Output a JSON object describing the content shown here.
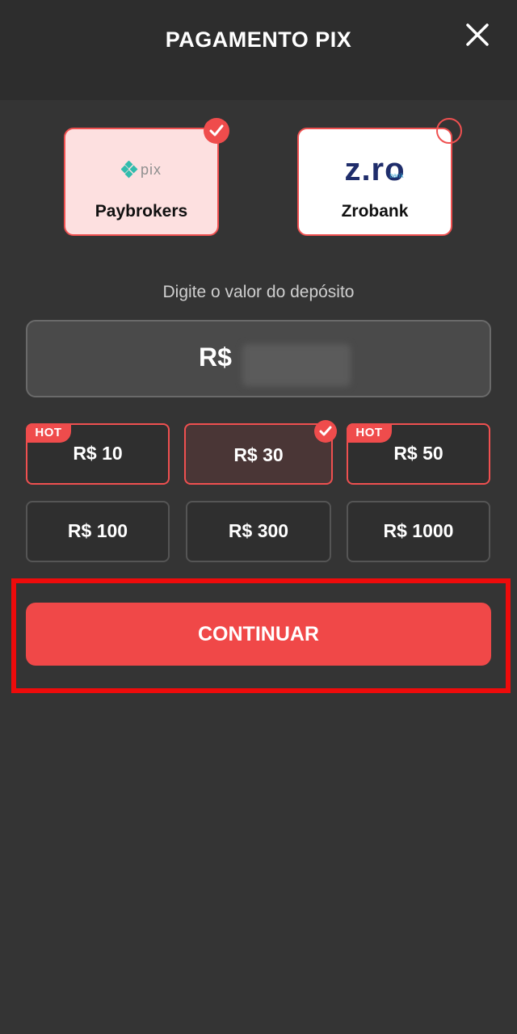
{
  "header": {
    "title": "PAGAMENTO PIX"
  },
  "providers": [
    {
      "name": "Paybrokers",
      "logo_text": "pix",
      "selected": true
    },
    {
      "name": "Zrobank",
      "logo_text": "z.ro",
      "logo_subtext": "bank",
      "selected": false
    }
  ],
  "deposit": {
    "label": "Digite o valor do depósito",
    "currency": "R$"
  },
  "amounts": [
    {
      "label": "R$ 10",
      "badge": "HOT"
    },
    {
      "label": "R$ 30",
      "selected": true
    },
    {
      "label": "R$ 50",
      "badge": "HOT"
    },
    {
      "label": "R$ 100"
    },
    {
      "label": "R$ 300"
    },
    {
      "label": "R$ 1000"
    }
  ],
  "cta": {
    "label": "CONTINUAR"
  },
  "colors": {
    "background": "#343434",
    "header": "#2d2d2d",
    "accent": "#f04848",
    "highlight": "#ee0b0b"
  }
}
